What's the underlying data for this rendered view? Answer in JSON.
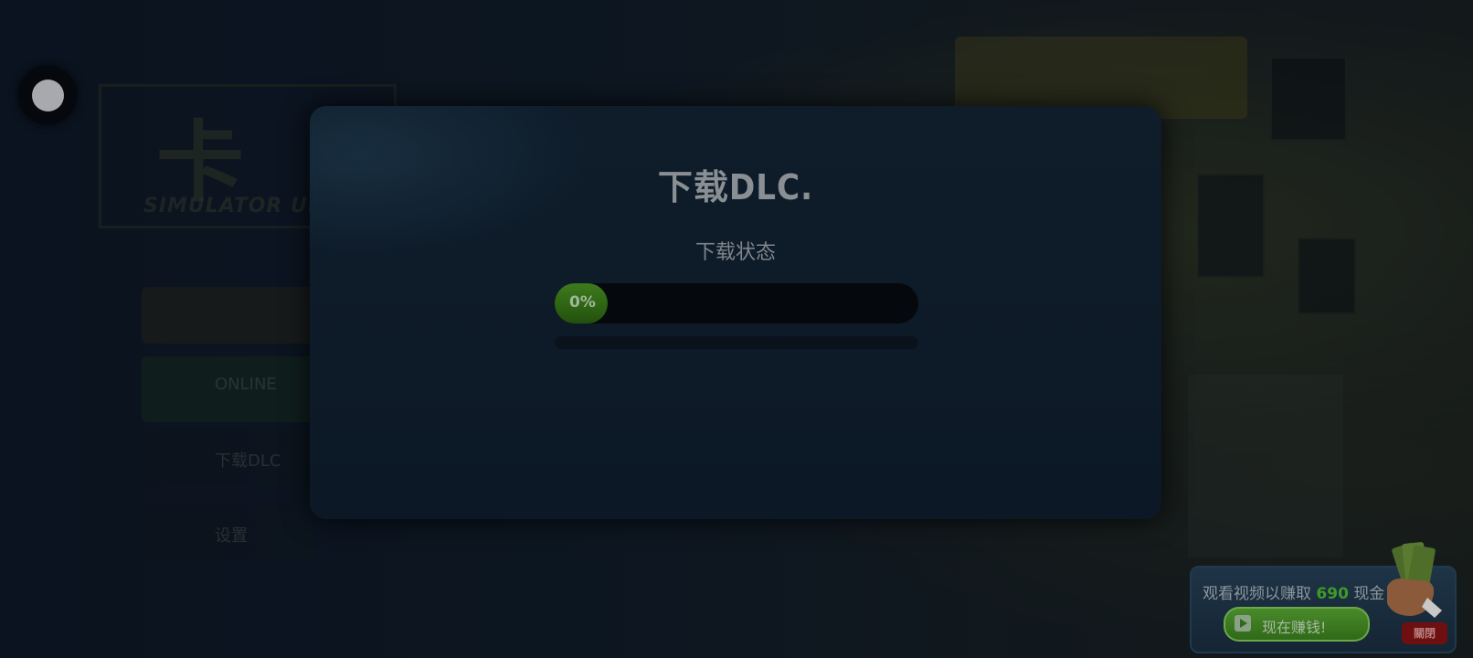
{
  "background": {
    "logo_glyph": "卡",
    "logo_sub": "SIMULATOR ULTI",
    "menu": [
      {
        "label": "",
        "accent": "orange"
      },
      {
        "label": "ONLINE",
        "accent": "green"
      },
      {
        "label": "下载DLC",
        "accent": "none"
      },
      {
        "label": "设置",
        "accent": "none"
      }
    ]
  },
  "back_button": {
    "icon": "circle-knob-icon"
  },
  "dialog": {
    "title": "下载DLC.",
    "status_label": "下载状态",
    "progress": {
      "value": 0,
      "text": "0%",
      "color": "#2d6212"
    }
  },
  "ad": {
    "text_before": "观看视频以赚取",
    "amount": "690",
    "text_after": "现金",
    "button_label": "现在赚钱!",
    "button_icon": "play-icon",
    "badge_icon": "money-hand-icon",
    "close_label": "關閉",
    "accent": "#3f9a2a"
  }
}
